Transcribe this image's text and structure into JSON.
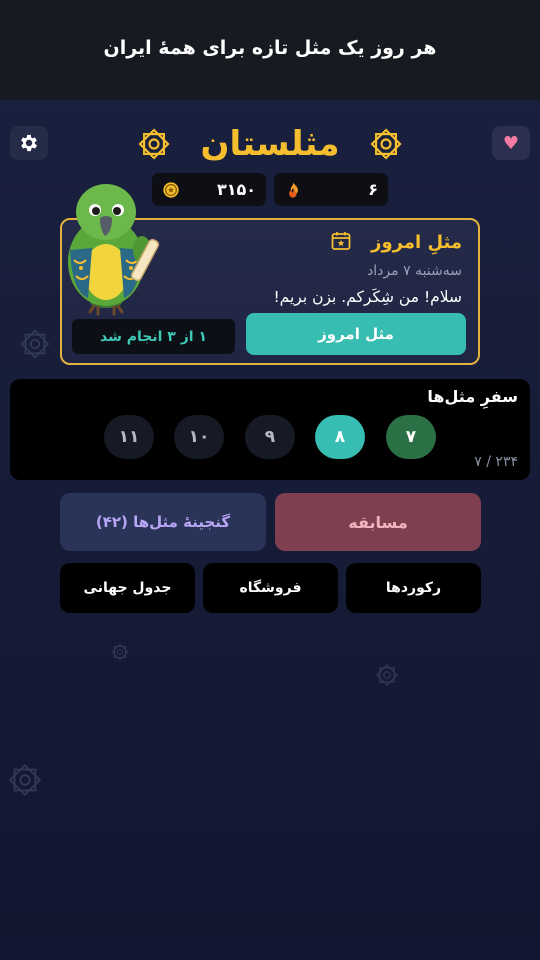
{
  "header": {
    "tagline": "هر روز یک مثل تازه برای همهٔ ایران"
  },
  "app": {
    "title": "مثلستان"
  },
  "stats": {
    "coins": "۳۱۵۰",
    "streak": "۶"
  },
  "daily": {
    "title": "مثلِ امروز",
    "date": "سه‌شنبه ۷ مرداد",
    "message": "سلام! من شِکَرکم. بزن بریم!",
    "button_label": "مثل امروز",
    "progress_label": "۱ از ۳ انجام شد"
  },
  "journey": {
    "title": "سفرِ مثل‌ها",
    "levels": [
      {
        "label": "۷",
        "state": "done"
      },
      {
        "label": "۸",
        "state": "current"
      },
      {
        "label": "۹",
        "state": "locked"
      },
      {
        "label": "۱۰",
        "state": "locked"
      },
      {
        "label": "۱۱",
        "state": "locked"
      }
    ],
    "count": "۷ / ۲۳۴"
  },
  "actions": {
    "contest": "مسابقه",
    "treasury": "گنجینهٔ مثل‌ها (۴۲)",
    "records": "رکوردها",
    "shop": "فروشگاه",
    "ranking": "جدول جهانی"
  },
  "icons": {
    "settings": "gear-icon",
    "favorite": "heart-icon",
    "coins": "coin-icon",
    "streak": "flame-icon",
    "calendar": "calendar-star-icon",
    "mascot": "parrot-mascot"
  },
  "colors": {
    "accent_gold": "#f5be2e",
    "teal": "#37bdb2",
    "contest": "#7e4050",
    "treasury": "#2a3358",
    "done_green": "#2c7045"
  }
}
